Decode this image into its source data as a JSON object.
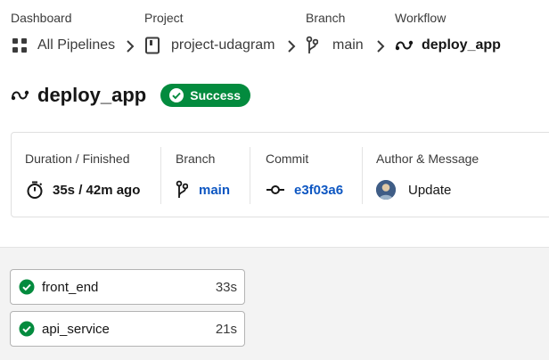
{
  "breadcrumb": {
    "dashboard": {
      "label": "Dashboard",
      "value": "All Pipelines"
    },
    "project": {
      "label": "Project",
      "value": "project-udagram"
    },
    "branch": {
      "label": "Branch",
      "value": "main"
    },
    "workflow": {
      "label": "Workflow",
      "value": "deploy_app"
    }
  },
  "workflow": {
    "title": "deploy_app",
    "status": "Success",
    "status_color": "#038b3e"
  },
  "summary": {
    "duration": {
      "label": "Duration / Finished",
      "value": "35s / 42m ago"
    },
    "branch": {
      "label": "Branch",
      "value": "main"
    },
    "commit": {
      "label": "Commit",
      "value": "e3f03a6"
    },
    "author": {
      "label": "Author & Message",
      "value": "Update"
    }
  },
  "jobs": [
    {
      "name": "front_end",
      "duration": "33s",
      "status": "success"
    },
    {
      "name": "api_service",
      "duration": "21s",
      "status": "success"
    }
  ],
  "colors": {
    "link": "#0e57c2",
    "success": "#038b3e"
  }
}
